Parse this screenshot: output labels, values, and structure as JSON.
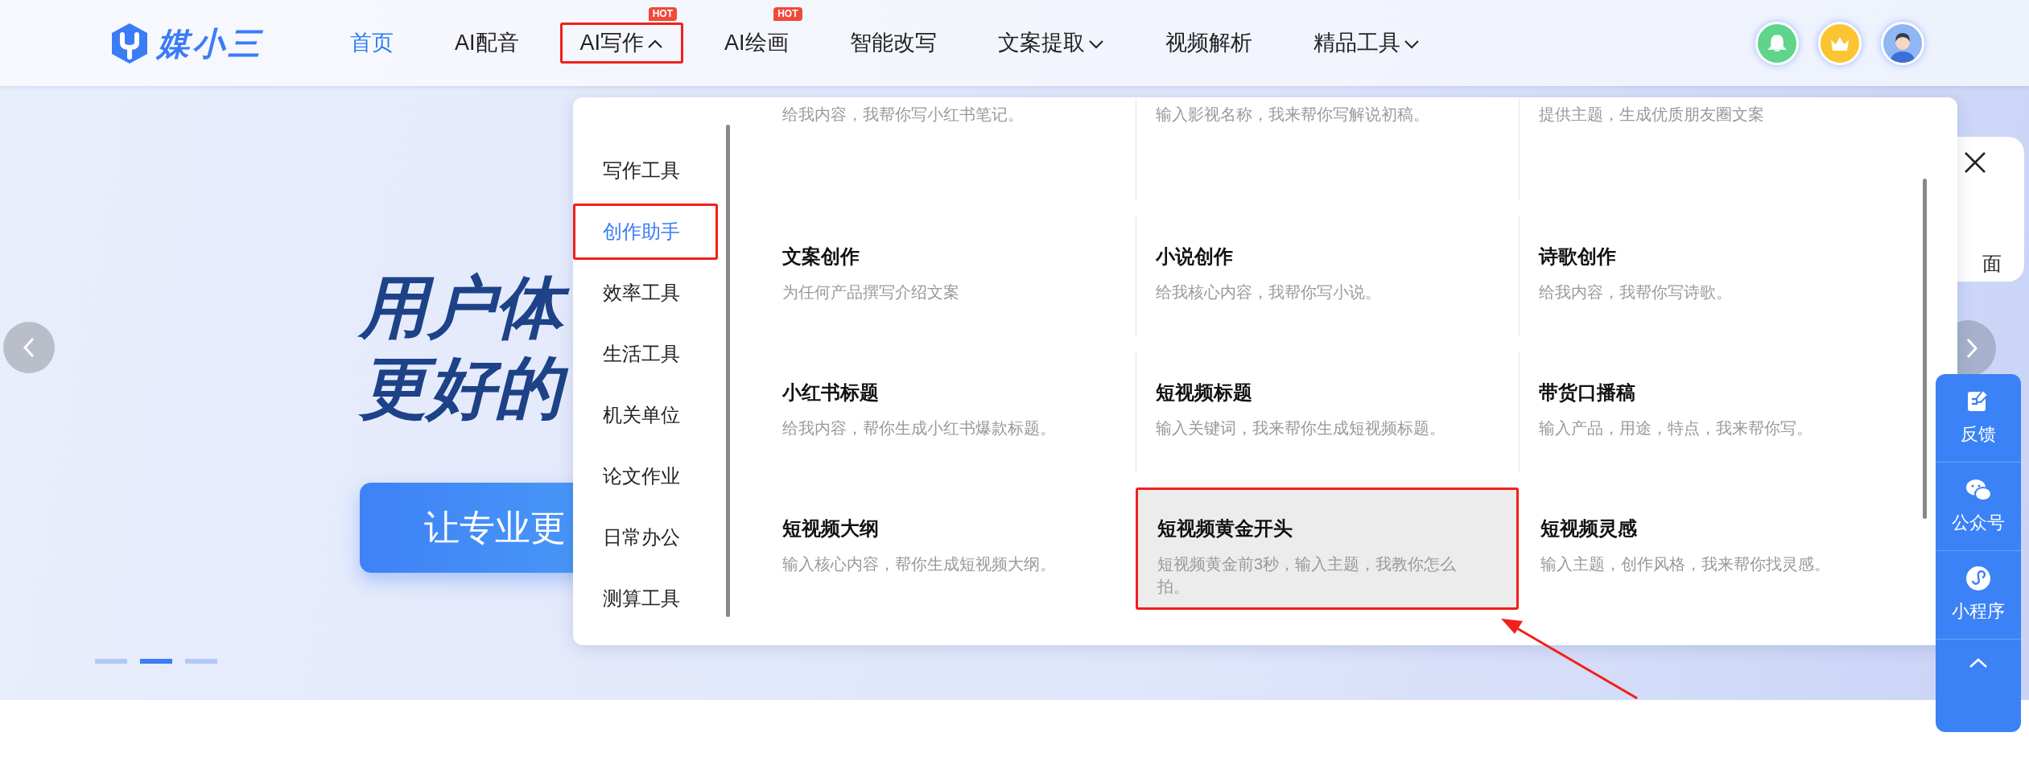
{
  "logo": {
    "text": "媒小三"
  },
  "nav": [
    {
      "label": "首页",
      "selected": true,
      "highlighted": false
    },
    {
      "label": "AI配音",
      "selected": false,
      "highlighted": false
    },
    {
      "label": "AI写作",
      "selected": false,
      "highlighted": true,
      "expanded": true,
      "badge": "HOT"
    },
    {
      "label": "AI绘画",
      "selected": false,
      "highlighted": false,
      "badge": "HOT"
    },
    {
      "label": "智能改写",
      "selected": false,
      "highlighted": false
    },
    {
      "label": "文案提取",
      "selected": false,
      "highlighted": false,
      "expanded": false
    },
    {
      "label": "视频解析",
      "selected": false,
      "highlighted": false
    },
    {
      "label": "精品工具",
      "selected": false,
      "highlighted": false,
      "expanded": false
    }
  ],
  "hero": {
    "heading_lines": [
      "用户体",
      "更好的"
    ],
    "button": "让专业更",
    "slides": [
      {
        "selected": false
      },
      {
        "selected": true
      },
      {
        "selected": false
      }
    ]
  },
  "dropdown": {
    "categories": [
      {
        "label": "写作工具",
        "selected": false,
        "highlighted": false
      },
      {
        "label": "创作助手",
        "selected": true,
        "highlighted": true
      },
      {
        "label": "效率工具",
        "selected": false,
        "highlighted": false
      },
      {
        "label": "生活工具",
        "selected": false,
        "highlighted": false
      },
      {
        "label": "机关单位",
        "selected": false,
        "highlighted": false
      },
      {
        "label": "论文作业",
        "selected": false,
        "highlighted": false
      },
      {
        "label": "日常办公",
        "selected": false,
        "highlighted": false
      },
      {
        "label": "测算工具",
        "selected": false,
        "highlighted": false
      }
    ],
    "tools": [
      {
        "desc": "给我内容，我帮你写小红书笔记。",
        "selected": false,
        "highlighted": false
      },
      {
        "desc": "输入影视名称，我来帮你写解说初稿。",
        "selected": false,
        "highlighted": false
      },
      {
        "desc": "提供主题，生成优质朋友圈文案",
        "selected": false,
        "highlighted": false
      },
      {
        "title": "文案创作",
        "desc": "为任何产品撰写介绍文案",
        "selected": false,
        "highlighted": false
      },
      {
        "title": "小说创作",
        "desc": "给我核心内容，我帮你写小说。",
        "selected": false,
        "highlighted": false
      },
      {
        "title": "诗歌创作",
        "desc": "给我内容，我帮你写诗歌。",
        "selected": false,
        "highlighted": false
      },
      {
        "title": "小红书标题",
        "desc": "给我内容，帮你生成小红书爆款标题。",
        "selected": false,
        "highlighted": false
      },
      {
        "title": "短视频标题",
        "desc": "输入关键词，我来帮你生成短视频标题。",
        "selected": false,
        "highlighted": false
      },
      {
        "title": "带货口播稿",
        "desc": "输入产品，用途，特点，我来帮你写。",
        "selected": false,
        "highlighted": false
      },
      {
        "title": "短视频大纲",
        "desc": "输入核心内容，帮你生成短视频大纲。",
        "selected": false,
        "highlighted": false
      },
      {
        "title": "短视频黄金开头",
        "desc": "短视频黄金前3秒，输入主题，我教你怎么拍。",
        "selected": true,
        "highlighted": true
      },
      {
        "title": "短视频灵感",
        "desc": "输入主题，创作风格，我来帮你找灵感。",
        "selected": false,
        "highlighted": false
      }
    ]
  },
  "side_panel": {
    "text": "面"
  },
  "float_bar": {
    "items": [
      {
        "label": "反馈",
        "kind": "feedback"
      },
      {
        "label": "公众号",
        "kind": "wechat"
      },
      {
        "label": "小程序",
        "kind": "miniapp"
      }
    ]
  }
}
